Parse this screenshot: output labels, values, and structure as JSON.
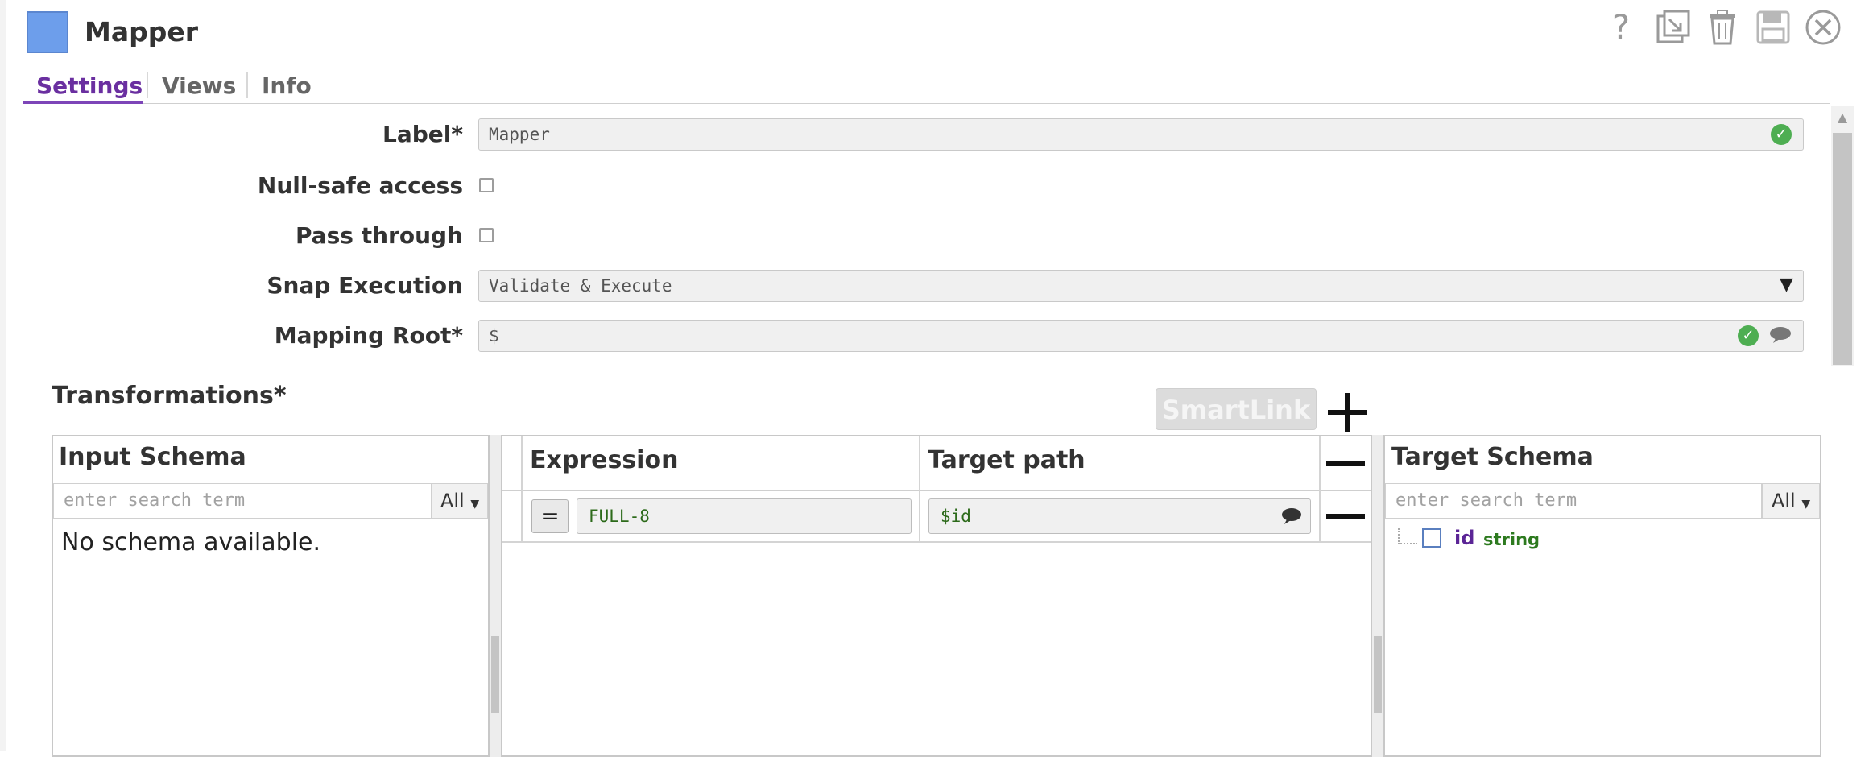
{
  "window": {
    "title": "Mapper",
    "accent_color": "#6d9eeb"
  },
  "header_icons": [
    "help-icon",
    "export-icon",
    "trash-icon",
    "save-icon",
    "close-icon"
  ],
  "tabs": [
    {
      "label": "Settings",
      "active": true
    },
    {
      "label": "Views",
      "active": false
    },
    {
      "label": "Info",
      "active": false
    }
  ],
  "form": {
    "label": {
      "name": "Label*",
      "value": "Mapper"
    },
    "null_safe": {
      "name": "Null-safe access",
      "checked": false
    },
    "pass_through": {
      "name": "Pass through",
      "checked": false
    },
    "snap_execution": {
      "name": "Snap Execution",
      "value": "Validate & Execute"
    },
    "mapping_root": {
      "name": "Mapping Root*",
      "value": "$"
    }
  },
  "transformations": {
    "title": "Transformations*",
    "smartlink_label": "SmartLink",
    "input_schema": {
      "title": "Input Schema",
      "search_placeholder": "enter search term",
      "filter": "All",
      "empty_text": "No schema available."
    },
    "mapping": {
      "expression_header": "Expression",
      "target_header": "Target path",
      "rows": [
        {
          "eq": "=",
          "expression": "FULL-8",
          "target": "$id"
        }
      ]
    },
    "target_schema": {
      "title": "Target Schema",
      "search_placeholder": "enter search term",
      "filter": "All",
      "fields": [
        {
          "name": "id",
          "type": "string"
        }
      ]
    }
  }
}
